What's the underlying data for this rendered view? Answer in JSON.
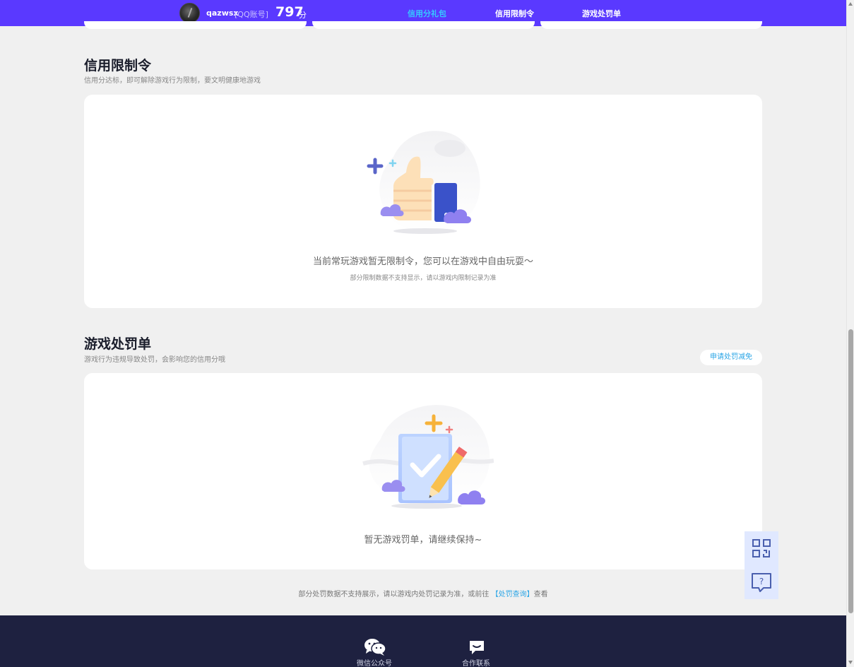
{
  "header": {
    "username": "qazwsx",
    "account_type": "[QQ账号]",
    "score": "797",
    "score_unit": "分",
    "tabs": [
      {
        "label": "信用分礼包",
        "active": true
      },
      {
        "label": "信用限制令",
        "active": false
      },
      {
        "label": "游戏处罚单",
        "active": false
      }
    ]
  },
  "restriction": {
    "title": "信用限制令",
    "subtitle": "信用分达标，即可解除游戏行为限制，要文明健康地游戏",
    "empty_main": "当前常玩游戏暂无限制令，您可以在游戏中自由玩耍～",
    "empty_sub": "部分限制数据不支持显示，请以游戏内限制记录为准"
  },
  "penalty": {
    "title": "游戏处罚单",
    "subtitle": "游戏行为违规导致处罚，会影响您的信用分哦",
    "appeal_button": "申请处罚减免",
    "empty_main": "暂无游戏罚单，请继续保持~"
  },
  "footnote": {
    "text_before": "部分处罚数据不支持展示，请以游戏内处罚记录为准，或前往",
    "link": "【处罚查询】",
    "text_after": "查看"
  },
  "footer": {
    "items": [
      {
        "label": "微信公众号",
        "icon": "wechat-icon"
      },
      {
        "label": "合作联系",
        "icon": "chat-bubble-icon"
      }
    ]
  },
  "colors": {
    "topbar": "#5a39ff",
    "active_tab": "#36c9ff",
    "link": "#2aa5e6",
    "footer": "#1e2140",
    "page_bg": "#f0f0f0"
  }
}
